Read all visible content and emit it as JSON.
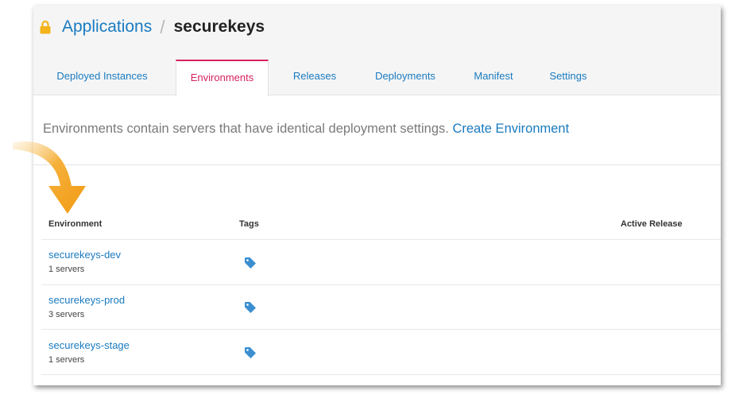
{
  "breadcrumb": {
    "parent": "Applications",
    "separator": "/",
    "current": "securekeys"
  },
  "tabs": [
    {
      "label": "Deployed Instances",
      "active": false
    },
    {
      "label": "Environments",
      "active": true
    },
    {
      "label": "Releases",
      "active": false
    },
    {
      "label": "Deployments",
      "active": false
    },
    {
      "label": "Manifest",
      "active": false
    },
    {
      "label": "Settings",
      "active": false
    }
  ],
  "intro": {
    "text": "Environments contain servers that have identical deployment settings.",
    "link": "Create Environment"
  },
  "table": {
    "headers": {
      "environment": "Environment",
      "tags": "Tags",
      "active_release": "Active Release"
    },
    "rows": [
      {
        "name": "securekeys-dev",
        "servers": "1 servers"
      },
      {
        "name": "securekeys-prod",
        "servers": "3 servers"
      },
      {
        "name": "securekeys-stage",
        "servers": "1 servers"
      }
    ]
  },
  "colors": {
    "link": "#1a7bc0",
    "active_tab": "#d6225f",
    "lock": "#f2b31b",
    "arrow": "#f5a623",
    "tag": "#3b8fd0"
  },
  "icons": {
    "lock": "lock-icon",
    "tag": "tag-icon",
    "arrow": "curved-arrow-icon"
  }
}
